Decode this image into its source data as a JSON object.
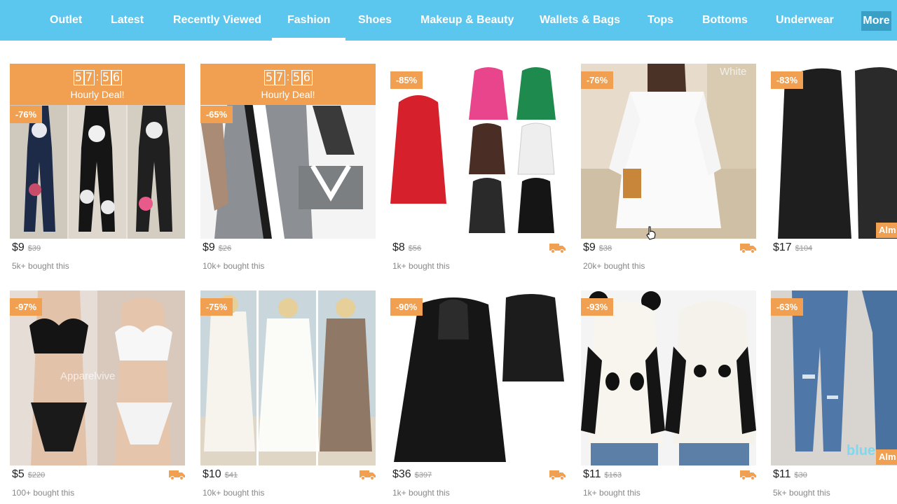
{
  "nav": {
    "tabs": [
      {
        "label": "Outlet"
      },
      {
        "label": "Latest"
      },
      {
        "label": "Recently Viewed"
      },
      {
        "label": "Fashion"
      },
      {
        "label": "Shoes"
      },
      {
        "label": "Makeup & Beauty"
      },
      {
        "label": "Wallets & Bags"
      },
      {
        "label": "Tops"
      },
      {
        "label": "Bottoms"
      },
      {
        "label": "Underwear"
      }
    ],
    "active_tab": "Fashion",
    "more_label": "More"
  },
  "deal_timer": {
    "digits": [
      "5",
      "7",
      "5",
      "6"
    ],
    "label": "Hourly Deal!"
  },
  "products": [
    {
      "discount": "-76%",
      "price": "$9",
      "old_price": "$39",
      "sold": "5k+ bought this",
      "hourly_deal": true,
      "shipping": false,
      "image": "patterned-jumpsuits"
    },
    {
      "discount": "-65%",
      "price": "$9",
      "old_price": "$26",
      "sold": "10k+ bought this",
      "hourly_deal": true,
      "shipping": false,
      "image": "grey-striped-dress"
    },
    {
      "discount": "-85%",
      "price": "$8",
      "old_price": "$56",
      "sold": "1k+ bought this",
      "hourly_deal": false,
      "shipping": true,
      "image": "zip-hoodies"
    },
    {
      "discount": "-76%",
      "price": "$9",
      "old_price": "$38",
      "sold": "20k+ bought this",
      "hourly_deal": false,
      "shipping": true,
      "image": "white-dress",
      "watermark": "White"
    },
    {
      "discount": "-83%",
      "price": "$17",
      "old_price": "$104",
      "sold": "",
      "hourly_deal": false,
      "shipping": false,
      "image": "fur-vest",
      "corner_tag": "Alm"
    },
    {
      "discount": "-97%",
      "price": "$5",
      "old_price": "$220",
      "sold": "100+ bought this",
      "hourly_deal": false,
      "shipping": true,
      "image": "lace-lingerie",
      "watermark": "Apparelvive"
    },
    {
      "discount": "-75%",
      "price": "$10",
      "old_price": "$41",
      "sold": "10k+ bought this",
      "hourly_deal": false,
      "shipping": true,
      "image": "lace-beach-dresses"
    },
    {
      "discount": "-90%",
      "price": "$36",
      "old_price": "$397",
      "sold": "1k+ bought this",
      "hourly_deal": false,
      "shipping": true,
      "image": "black-leather-jacket"
    },
    {
      "discount": "-93%",
      "price": "$11",
      "old_price": "$163",
      "sold": "1k+ bought this",
      "hourly_deal": false,
      "shipping": true,
      "image": "panda-hoodie"
    },
    {
      "discount": "-63%",
      "price": "$11",
      "old_price": "$30",
      "sold": "5k+ bought this",
      "hourly_deal": false,
      "shipping": false,
      "image": "ripped-jeans",
      "watermark": "blue",
      "corner_tag": "Alm"
    }
  ],
  "colors": {
    "nav_bg": "#5bc6ee",
    "accent": "#f0a050",
    "more_bg": "#3a9fc5"
  }
}
